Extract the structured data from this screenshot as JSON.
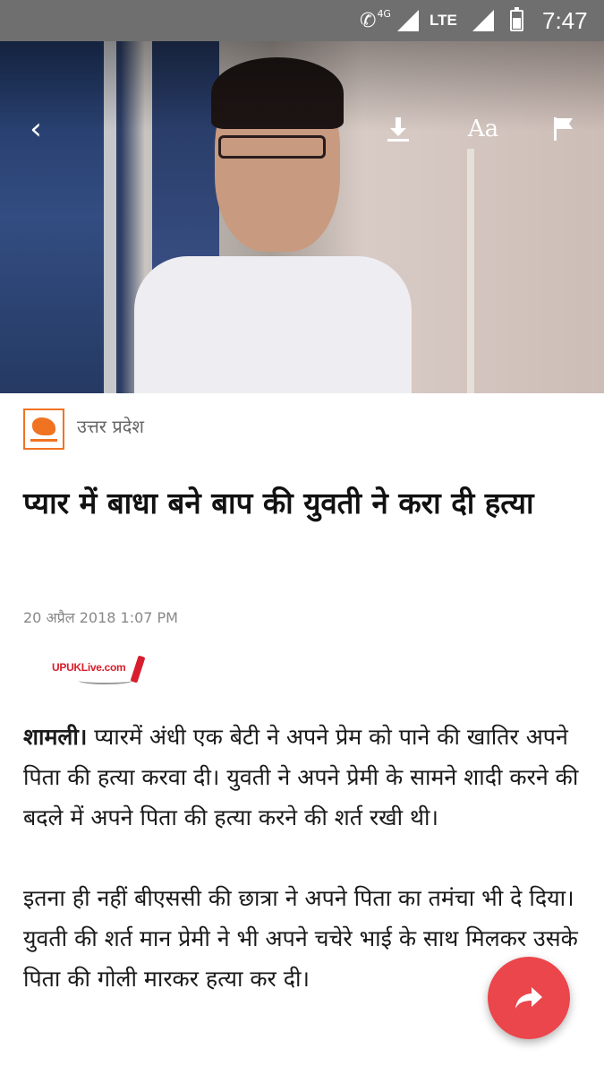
{
  "status_bar": {
    "network_label": "4G",
    "lte_label": "LTE",
    "time": "7:47",
    "icons": [
      "call-icon",
      "signal-icon",
      "signal-icon",
      "battery-icon"
    ]
  },
  "toolbar": {
    "back_icon": "‹",
    "text_size_label": "Aa",
    "icons": [
      "back-icon",
      "download-icon",
      "text-size-icon",
      "flag-icon"
    ]
  },
  "article": {
    "source_name": "उत्तर प्रदेश",
    "headline": "प्यार में बाधा बने बाप की युवती ने करा दी हत्या",
    "date": "20 अप्रैल 2018 1:07 PM",
    "watermark_text": "UPUKLive.com",
    "dateline": "शामली।",
    "para1": " प्यारमें अंधी एक बेटी ने अपने प्रेम को पाने की खातिर अपने पिता की हत्या करवा दी। युवती ने अपने प्रेमी के सामने शादी करने की बदले में अपने पिता की हत्या करने की शर्त रखी थी।",
    "para2": "इतना ही नहीं बीएससी की छात्रा ने अपने पिता का तमंचा भी दे दिया। युवती की शर्त मान प्रेमी ने भी अपने चचेरे भाई के साथ मिलकर उसके पिता की गोली मारकर हत्या कर दी।"
  },
  "fab": {
    "icon": "share-icon"
  },
  "colors": {
    "accent": "#e8363c",
    "source_orange": "#f07322",
    "status_bar": "#6f6f6f"
  }
}
